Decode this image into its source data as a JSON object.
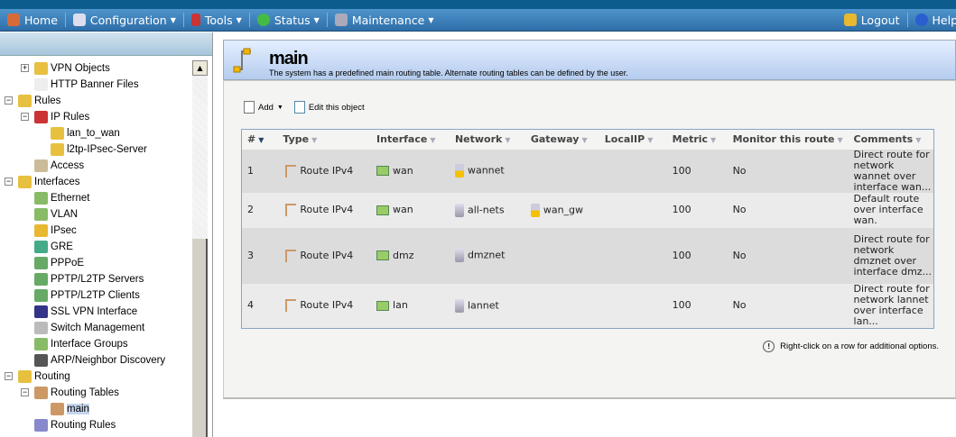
{
  "nav": {
    "items": [
      {
        "label": "Home",
        "icon": "home-icon"
      },
      {
        "label": "Configuration",
        "icon": "configuration-icon"
      },
      {
        "label": "Tools",
        "icon": "tools-icon"
      },
      {
        "label": "Status",
        "icon": "status-icon"
      },
      {
        "label": "Maintenance",
        "icon": "maintenance-icon"
      }
    ],
    "logout": "Logout",
    "help": "Help"
  },
  "tree": [
    {
      "label": "VPN Objects"
    },
    {
      "label": "HTTP Banner Files"
    },
    {
      "label": "Rules"
    },
    {
      "label": "IP Rules"
    },
    {
      "label": "lan_to_wan"
    },
    {
      "label": "l2tp-IPsec-Server"
    },
    {
      "label": "Access"
    },
    {
      "label": "Interfaces"
    },
    {
      "label": "Ethernet"
    },
    {
      "label": "VLAN"
    },
    {
      "label": "IPsec"
    },
    {
      "label": "GRE"
    },
    {
      "label": "PPPoE"
    },
    {
      "label": "PPTP/L2TP Servers"
    },
    {
      "label": "PPTP/L2TP Clients"
    },
    {
      "label": "SSL VPN Interface"
    },
    {
      "label": "Switch Management"
    },
    {
      "label": "Interface Groups"
    },
    {
      "label": "ARP/Neighbor Discovery"
    },
    {
      "label": "Routing"
    },
    {
      "label": "Routing Tables"
    },
    {
      "label": "main"
    },
    {
      "label": "Routing Rules"
    }
  ],
  "header": {
    "title": "main",
    "description": "The system has a predefined main routing table. Alternate routing tables can be defined by the user."
  },
  "toolbar": {
    "add": "Add",
    "edit": "Edit this object"
  },
  "table": {
    "columns": [
      "#",
      "Type",
      "Interface",
      "Network",
      "Gateway",
      "LocalIP",
      "Metric",
      "Monitor this route",
      "Comments"
    ],
    "rows": [
      {
        "num": "1",
        "type": "Route IPv4",
        "interface": "wan",
        "network": "wannet",
        "gateway": "",
        "localip": "",
        "metric": "100",
        "monitor": "No",
        "comments": "Direct route for network wannet over interface wan..."
      },
      {
        "num": "2",
        "type": "Route IPv4",
        "interface": "wan",
        "network": "all-nets",
        "gateway": "wan_gw",
        "localip": "",
        "metric": "100",
        "monitor": "No",
        "comments": "Default route over interface wan."
      },
      {
        "num": "3",
        "type": "Route IPv4",
        "interface": "dmz",
        "network": "dmznet",
        "gateway": "",
        "localip": "",
        "metric": "100",
        "monitor": "No",
        "comments": "Direct route for network dmznet over interface dmz..."
      },
      {
        "num": "4",
        "type": "Route IPv4",
        "interface": "lan",
        "network": "lannet",
        "gateway": "",
        "localip": "",
        "metric": "100",
        "monitor": "No",
        "comments": "Direct route for network lannet over interface lan..."
      }
    ]
  },
  "hint": "Right-click on a row for additional options."
}
